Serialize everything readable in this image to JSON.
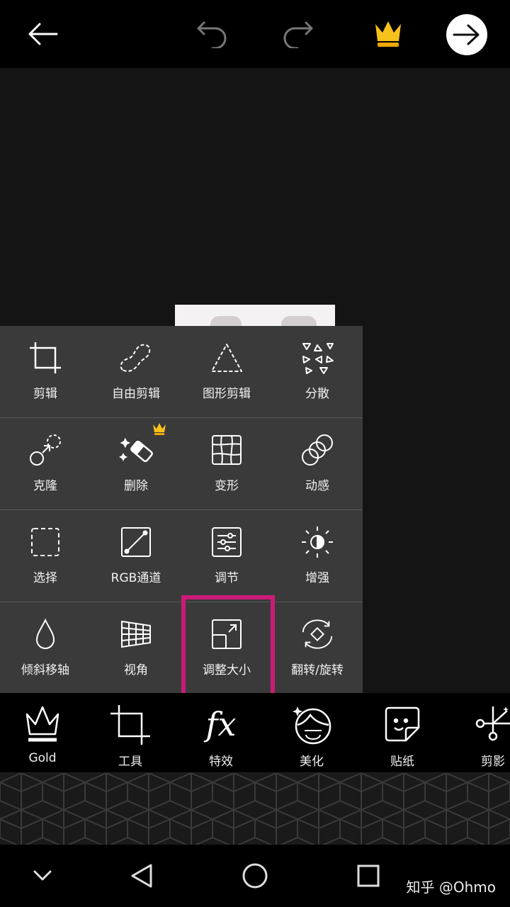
{
  "toolbar": {
    "back_icon": "back-arrow-icon",
    "undo_icon": "undo-icon",
    "redo_icon": "redo-icon",
    "premium_icon": "crown-icon",
    "next_icon": "next-arrow-icon"
  },
  "tools_panel": {
    "rows": [
      [
        {
          "label": "剪辑",
          "icon": "crop-icon"
        },
        {
          "label": "自由剪辑",
          "icon": "freeform-crop-icon"
        },
        {
          "label": "图形剪辑",
          "icon": "shape-crop-icon"
        },
        {
          "label": "分散",
          "icon": "disperse-icon"
        }
      ],
      [
        {
          "label": "克隆",
          "icon": "clone-icon"
        },
        {
          "label": "删除",
          "icon": "eraser-icon",
          "premium": true
        },
        {
          "label": "变形",
          "icon": "warp-icon"
        },
        {
          "label": "动感",
          "icon": "motion-icon"
        }
      ],
      [
        {
          "label": "选择",
          "icon": "select-icon"
        },
        {
          "label": "RGB通道",
          "icon": "rgb-curve-icon"
        },
        {
          "label": "调节",
          "icon": "adjust-icon"
        },
        {
          "label": "增强",
          "icon": "enhance-icon"
        }
      ],
      [
        {
          "label": "倾斜移轴",
          "icon": "tilt-shift-icon"
        },
        {
          "label": "视角",
          "icon": "perspective-icon"
        },
        {
          "label": "调整大小",
          "icon": "resize-icon",
          "highlighted": true
        },
        {
          "label": "翻转/旋转",
          "icon": "flip-rotate-icon"
        }
      ]
    ]
  },
  "bottom_nav": [
    {
      "label": "Gold",
      "icon": "gold-crown-icon",
      "active": true
    },
    {
      "label": "工具",
      "icon": "tools-crop-icon"
    },
    {
      "label": "特效",
      "icon": "fx-icon"
    },
    {
      "label": "美化",
      "icon": "beautify-face-icon"
    },
    {
      "label": "贴纸",
      "icon": "sticker-icon"
    },
    {
      "label": "剪影",
      "icon": "cutout-icon"
    }
  ],
  "system_nav": {
    "items": [
      "hide-keyboard-icon",
      "back-triangle-icon",
      "home-circle-icon",
      "recents-square-icon"
    ]
  },
  "watermark": "知乎 @Ohmo",
  "colors": {
    "highlight": "#cc1a78",
    "premium_gold": "#f5b800",
    "panel_bg": "#3a3a3a"
  }
}
